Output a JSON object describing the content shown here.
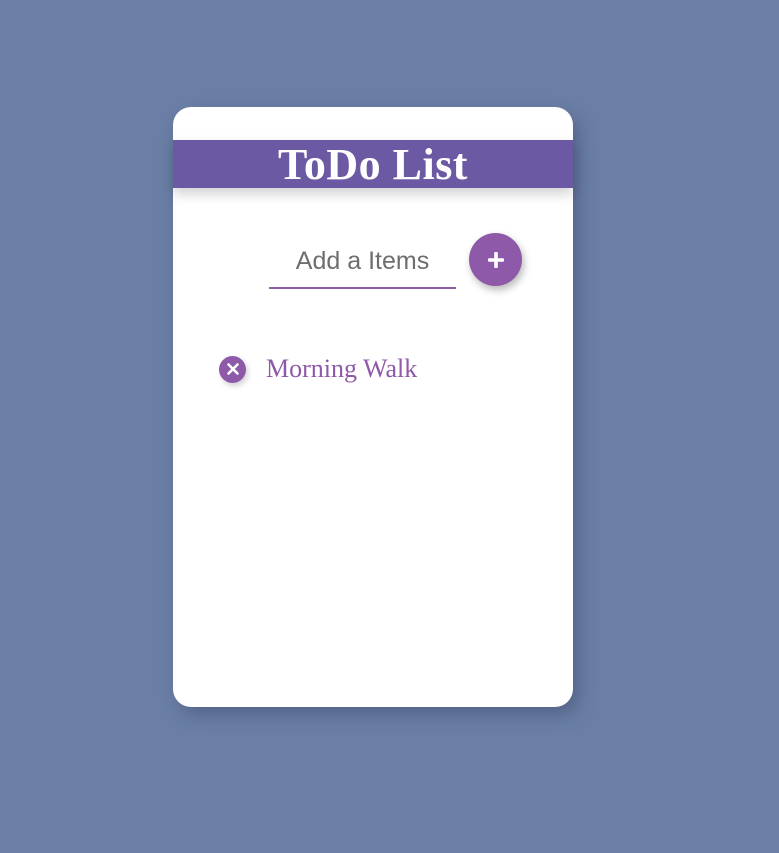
{
  "app": {
    "title": "ToDo List"
  },
  "input": {
    "placeholder": "Add a Items",
    "value": ""
  },
  "add_button": {
    "icon": "plus-icon",
    "symbol": "+"
  },
  "items": [
    {
      "text": "Morning Walk",
      "delete_icon": "close-icon"
    }
  ],
  "colors": {
    "background": "#6b7fa6",
    "card": "#ffffff",
    "header": "#6b5aa3",
    "accent": "#8e59a8",
    "title_text": "#ffffff"
  }
}
